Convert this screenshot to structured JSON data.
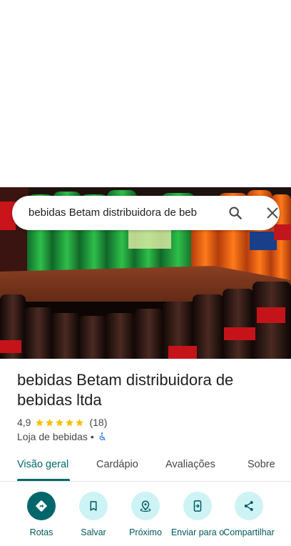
{
  "search": {
    "query": "bebidas Betam distribuidora de beb"
  },
  "place": {
    "title": "bebidas Betam distribuidora de bebidas ltda",
    "rating": "4,9",
    "stars": 5,
    "review_count": "(18)",
    "category": "Loja de bebidas",
    "separator": "•"
  },
  "tabs": [
    {
      "label": "Visão geral",
      "active": true
    },
    {
      "label": "Cardápio",
      "active": false
    },
    {
      "label": "Avaliações",
      "active": false
    },
    {
      "label": "Sobre",
      "active": false
    }
  ],
  "actions": [
    {
      "label": "Rotas",
      "icon": "directions-icon"
    },
    {
      "label": "Salvar",
      "icon": "bookmark-icon"
    },
    {
      "label": "Próximo",
      "icon": "nearby-icon"
    },
    {
      "label": "Enviar para o",
      "icon": "send-to-phone-icon"
    },
    {
      "label": "Compartilhar",
      "icon": "share-icon"
    }
  ],
  "colors": {
    "accent": "#006a6a",
    "action_bg": "#cdf3f5",
    "star": "#fbbc04"
  }
}
